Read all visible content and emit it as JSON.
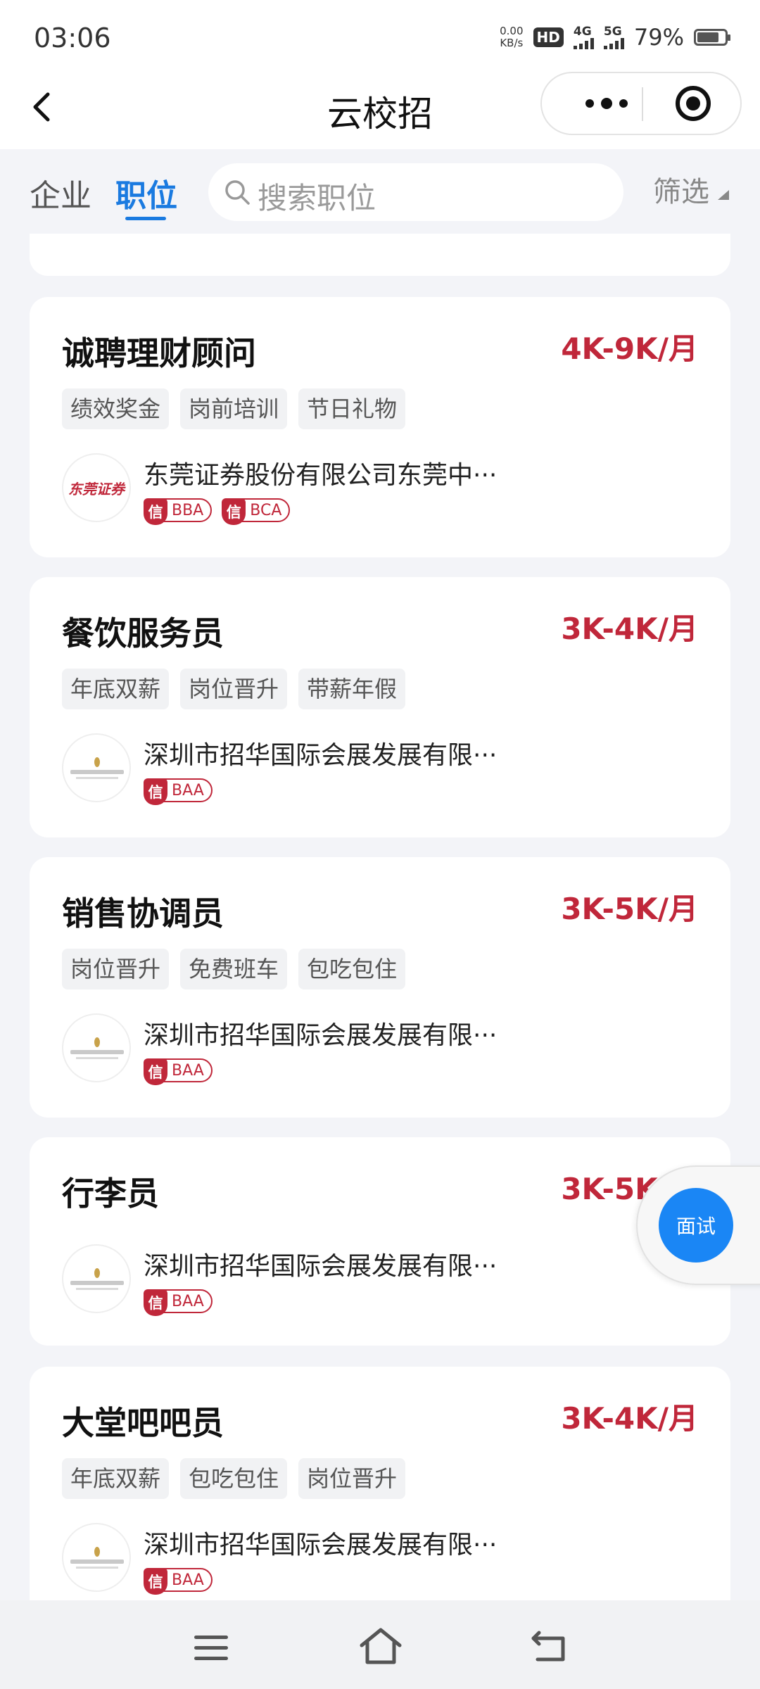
{
  "status_bar": {
    "time": "03:06",
    "net_speed_value": "0.00",
    "net_speed_unit": "KB/s",
    "hd": "HD",
    "sim1": "4G",
    "sim2": "5G",
    "battery_percent": "79%",
    "battery_level": 0.79
  },
  "nav": {
    "title": "云校招"
  },
  "tabs": {
    "company": "企业",
    "position": "职位",
    "active": "position"
  },
  "search": {
    "placeholder": "搜索职位"
  },
  "filter": {
    "label": "筛选"
  },
  "jobs": [
    {
      "title": "诚聘理财顾问",
      "salary": "4K-9K/月",
      "tags": [
        "绩效奖金",
        "岗前培训",
        "节日礼物"
      ],
      "company": "东莞证券股份有限公司东莞中···",
      "logo": "东莞证券",
      "badges": [
        {
          "icon": "信",
          "code": "BBA"
        },
        {
          "icon": "信",
          "code": "BCA"
        }
      ]
    },
    {
      "title": "餐饮服务员",
      "salary": "3K-4K/月",
      "tags": [
        "年底双薪",
        "岗位晋升",
        "带薪年假"
      ],
      "company": "深圳市招华国际会展发展有限···",
      "badges": [
        {
          "icon": "信",
          "code": "BAA"
        }
      ]
    },
    {
      "title": "销售协调员",
      "salary": "3K-5K/月",
      "tags": [
        "岗位晋升",
        "免费班车",
        "包吃包住"
      ],
      "company": "深圳市招华国际会展发展有限···",
      "badges": [
        {
          "icon": "信",
          "code": "BAA"
        }
      ]
    },
    {
      "title": "行李员",
      "salary": "3K-5K/月",
      "tags": [],
      "company": "深圳市招华国际会展发展有限···",
      "badges": [
        {
          "icon": "信",
          "code": "BAA"
        }
      ]
    },
    {
      "title": "大堂吧吧员",
      "salary": "3K-4K/月",
      "tags": [
        "年底双薪",
        "包吃包住",
        "岗位晋升"
      ],
      "company": "深圳市招华国际会展发展有限···",
      "badges": [
        {
          "icon": "信",
          "code": "BAA"
        }
      ]
    }
  ],
  "float_button": {
    "label": "面试"
  },
  "icons": {
    "back": "chevron-left-icon",
    "more": "more-dots-icon",
    "close": "target-circle-icon",
    "search": "search-icon",
    "filter": "triangle-down-icon",
    "sys_menu": "menu-icon",
    "sys_home": "home-icon",
    "sys_back": "back-arrow-icon"
  },
  "colors": {
    "accent": "#1a7ae0",
    "salary": "#c0273a",
    "float_button": "#1a86f5"
  }
}
